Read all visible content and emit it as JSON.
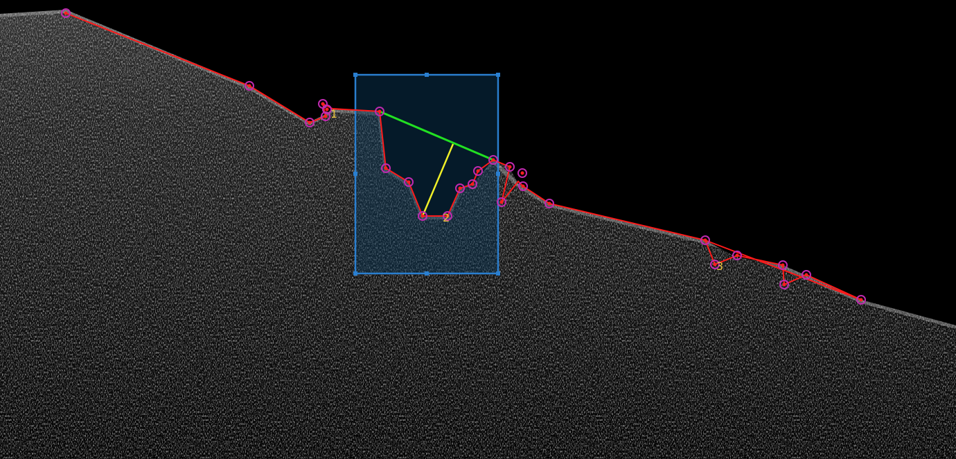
{
  "image": {
    "kind": "oct-bscan-grayscale",
    "background": "#000000",
    "tissue_color": "#d9d9d9"
  },
  "annotation": {
    "boundary_color": "#ff1a1a",
    "node_ring_color": "#c02ab0",
    "node_core_color": "#ff2020",
    "chord_color": "#22e022",
    "depth_color": "#f0f028",
    "label_color": "#e8c040",
    "selection_border": "#2a7fd0",
    "selection_fill": "#0a3a5a",
    "vertex_labels": [
      "1",
      "2",
      "3"
    ]
  }
}
